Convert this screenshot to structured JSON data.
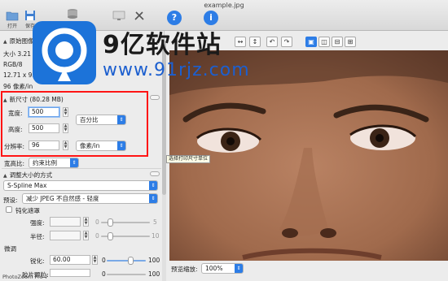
{
  "window": {
    "title": "example.jpg"
  },
  "toolbar": {
    "open_label": "打开",
    "save_label": "保存"
  },
  "left": {
    "original_section": "原始图像",
    "size_line": "大小 3.21 M",
    "color_line": "RGB/8",
    "dim_line": "12.71 x 9.58",
    "res_line": "96 像素/in",
    "new_size_section": "新尺寸 (80.28 MB)",
    "width_label": "宽度:",
    "width_value": "500",
    "height_label": "高度:",
    "height_value": "500",
    "unit_percent": "百分比",
    "res_label": "分辨率:",
    "res_value": "96",
    "res_unit": "像素/in",
    "aspect_label": "宽高比:",
    "aspect_value": "约束比例",
    "method_section": "调整大小的方式",
    "method_value": "S-Spline Max",
    "preset_label": "预设:",
    "preset_value": "减少 JPEG 不自然感 - 轻度",
    "mask_label": "钝化遮罩",
    "strength_label": "强度:",
    "strength_min": "0",
    "strength_max": "5",
    "radius_label": "半径:",
    "radius_min": "0",
    "radius_max": "10",
    "fine_label": "微调",
    "sharp_label": "锐化:",
    "sharp_value": "60.00",
    "sharp_min": "0",
    "sharp_max": "100",
    "film_label": "胶片颗粒:",
    "film_min": "0",
    "film_max": "100",
    "app_name": "PhotoZoom Pro 7"
  },
  "view": {
    "tooltip": "选择打印尺寸单位",
    "zoom_label": "预览缩放:",
    "zoom_value": "100%"
  },
  "watermark": {
    "brand": "9亿软件站",
    "url": "www.91rjz.com"
  },
  "colors": {
    "accent": "#2d7de6",
    "highlight": "#ff1414"
  }
}
